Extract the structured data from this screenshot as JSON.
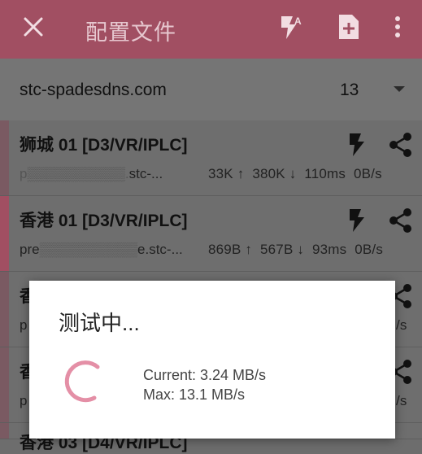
{
  "toolbar": {
    "title": "配置文件",
    "close_icon": "close-icon",
    "actions": [
      "flash-auto-icon",
      "add-file-icon",
      "more-vert-icon"
    ],
    "accent_color": "#a14f62"
  },
  "group": {
    "name": "stc-spadesdns.com",
    "count": "13"
  },
  "nodes": [
    {
      "name": "狮城 01 [D3/VR/IPLC]",
      "address_tail": "stc-...",
      "upload": "33K ↑",
      "download": "380K ↓",
      "latency": "110ms",
      "speed": "0B/s",
      "selected": false
    },
    {
      "name": "香港 01 [D3/VR/IPLC]",
      "address_tail": "e.stc-...",
      "upload": "869B ↑",
      "download": "567B ↓",
      "latency": "93ms",
      "speed": "0B/s",
      "selected": true
    },
    {
      "name": "香",
      "address_tail": "p",
      "speed": "/s",
      "selected": false
    },
    {
      "name": "香",
      "address_tail": "p",
      "speed": "/s",
      "selected": false
    },
    {
      "name": "香港 03 [D4/VR/IPLC]",
      "selected": false
    }
  ],
  "dialog": {
    "title": "测试中...",
    "current": "Current: 3.24 MB/s",
    "max": "Max: 13.1 MB/s",
    "spinner_color": "#e48fa6"
  }
}
